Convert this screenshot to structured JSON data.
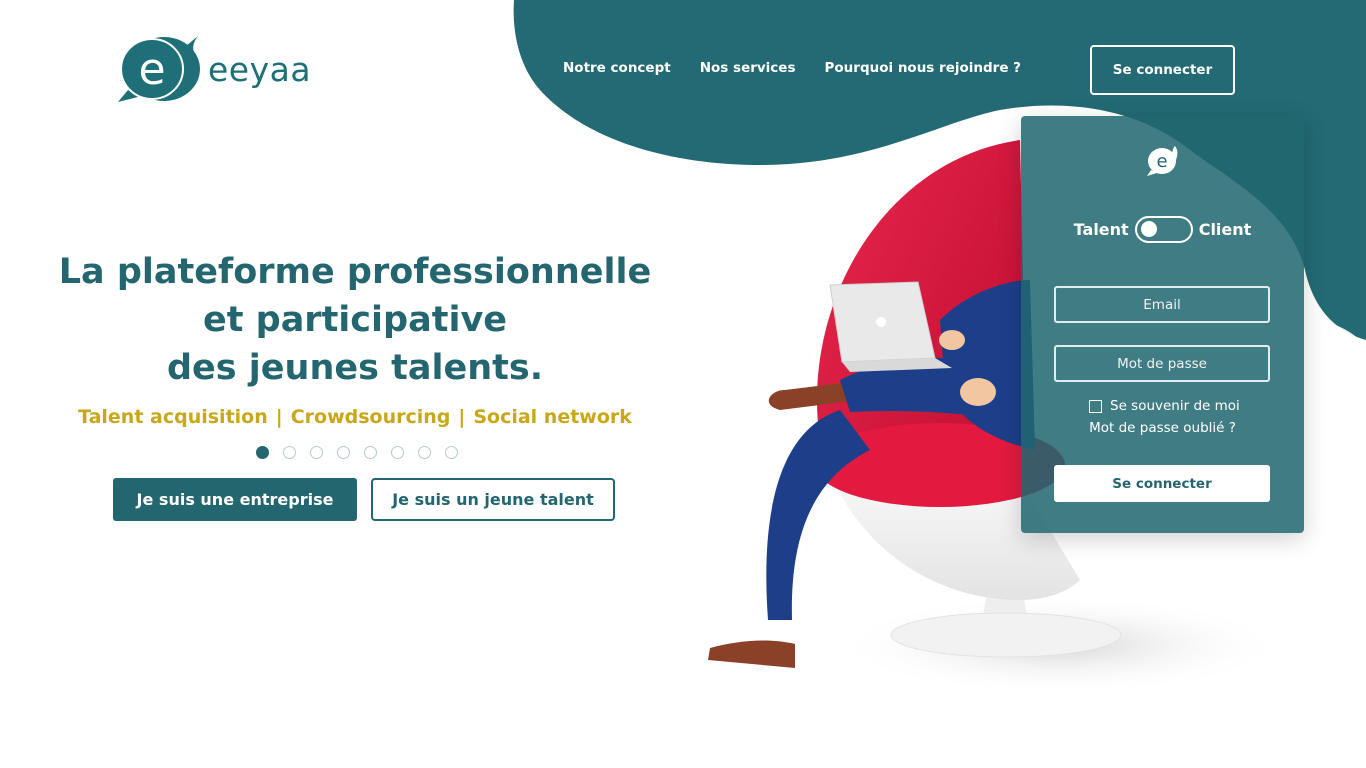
{
  "brand": {
    "name": "eeyaa",
    "logo_icon": "speech-bubble-e-icon",
    "primary_color": "#246670",
    "accent_color": "#c8a719"
  },
  "nav": {
    "items": [
      {
        "label": "Notre concept"
      },
      {
        "label": "Nos services"
      },
      {
        "label": "Pourquoi nous rejoindre ?"
      }
    ],
    "login_label": "Se connecter"
  },
  "hero": {
    "title_lines": [
      "La plateforme professionnelle",
      "et participative",
      "des jeunes talents."
    ],
    "tags": [
      "Talent acquisition",
      "Crowdsourcing",
      "Social network"
    ],
    "tag_separator": "|",
    "slides_total": 8,
    "active_slide": 1,
    "buttons": {
      "company": "Je suis une entreprise",
      "talent": "Je suis un jeune talent"
    }
  },
  "login_panel": {
    "toggle_left": "Talent",
    "toggle_right": "Client",
    "email_placeholder": "Email",
    "password_placeholder": "Mot de passe",
    "remember_label": "Se souvenir de moi",
    "forgot_label": "Mot de passe oublié ?",
    "submit_label": "Se connecter"
  }
}
